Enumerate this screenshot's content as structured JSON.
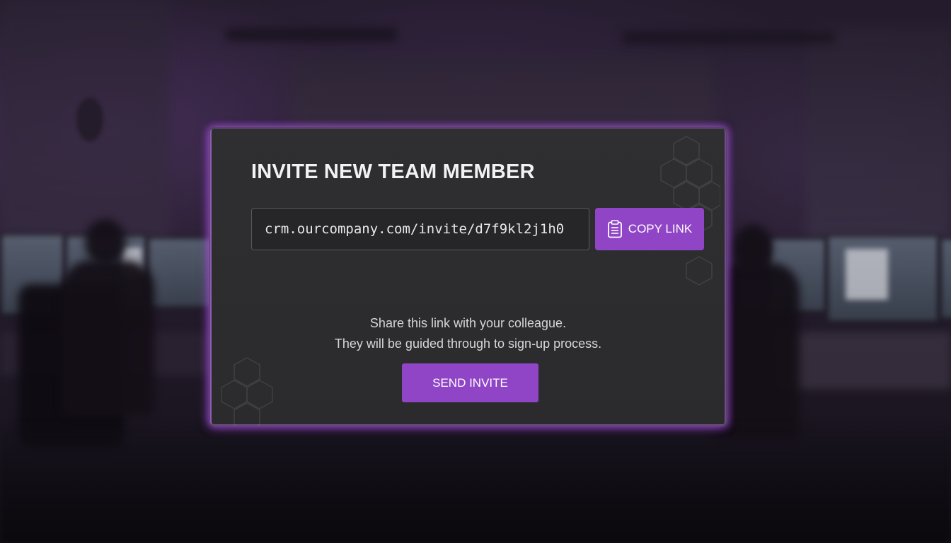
{
  "dialog": {
    "title": "INVITE NEW TEAM MEMBER",
    "invite_link": "crm.ourcompany.com/invite/d7f9kl2j1h0",
    "copy_button_label": "COPY LINK",
    "copy_button_icon": "clipboard-icon",
    "helper_lines": [
      "Share this link with your colleague.",
      "They will be guided through to sign-up process."
    ],
    "send_button_label": "SEND INVITE"
  },
  "colors": {
    "accent": "#8f45c6",
    "modal_background": "#2d2d2f",
    "modal_glow": "#aa50e6"
  }
}
